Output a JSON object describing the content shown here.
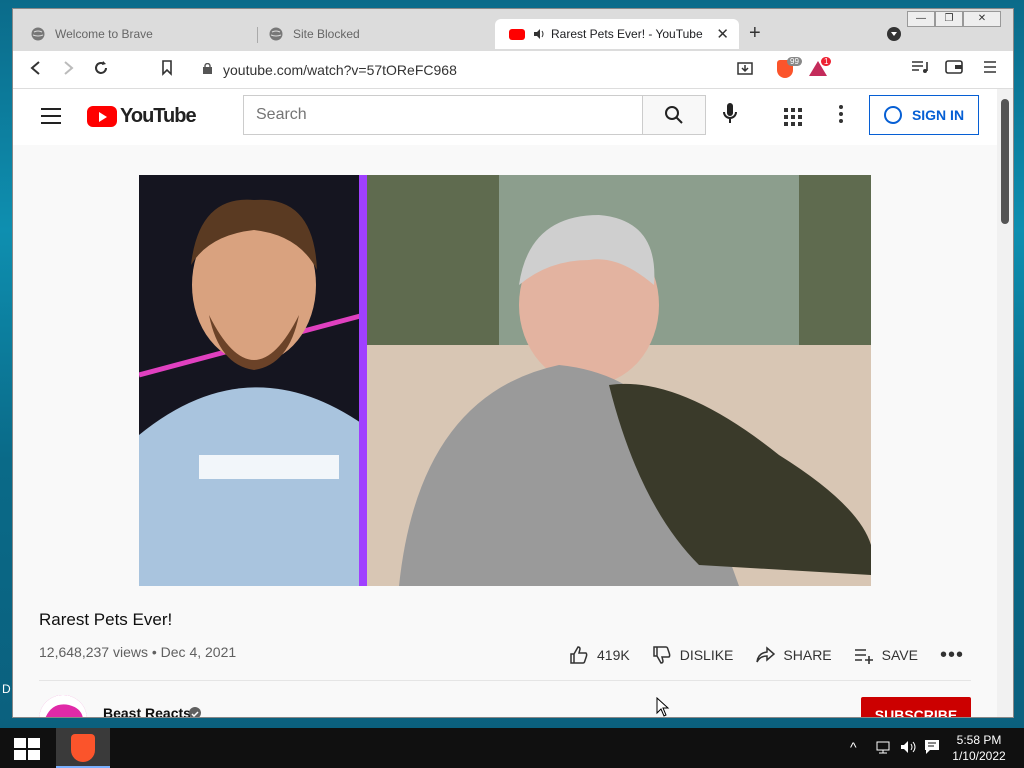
{
  "desktop": {
    "edge_label": "D"
  },
  "window": {
    "controls": {
      "minimize": "—",
      "restore": "❐",
      "close": "✕"
    }
  },
  "tabs": [
    {
      "title": "Welcome to Brave",
      "icon": "globe-icon",
      "active": false
    },
    {
      "title": "Site Blocked",
      "icon": "globe-icon",
      "active": false
    },
    {
      "title": "Rarest Pets Ever! - YouTube",
      "icon": "youtube-icon",
      "active": true,
      "audio": true
    }
  ],
  "new_tab_label": "+",
  "toolbar": {
    "url": "youtube.com/watch?v=57tOReFC968",
    "shield_badge": "99",
    "rewards_badge": "1"
  },
  "youtube": {
    "logo_text": "YouTube",
    "search_placeholder": "Search",
    "sign_in_label": "SIGN IN",
    "video": {
      "title": "Rarest Pets Ever!",
      "views": "12,648,237 views",
      "date": "Dec 4, 2021",
      "meta_separator": "•"
    },
    "actions": {
      "like_count": "419K",
      "dislike_label": "DISLIKE",
      "share_label": "SHARE",
      "save_label": "SAVE",
      "more_label": "•••"
    },
    "channel": {
      "name": "Beast Reacts",
      "verified": true,
      "subscribe_label": "SUBSCRIBE"
    }
  },
  "taskbar": {
    "time": "5:58 PM",
    "date": "1/10/2022",
    "tray_chevron": "^"
  },
  "colors": {
    "youtube_red": "#ff0000",
    "sign_in_blue": "#065fd4",
    "subscribe_red": "#cc0000",
    "brave_orange": "#fb542b"
  }
}
